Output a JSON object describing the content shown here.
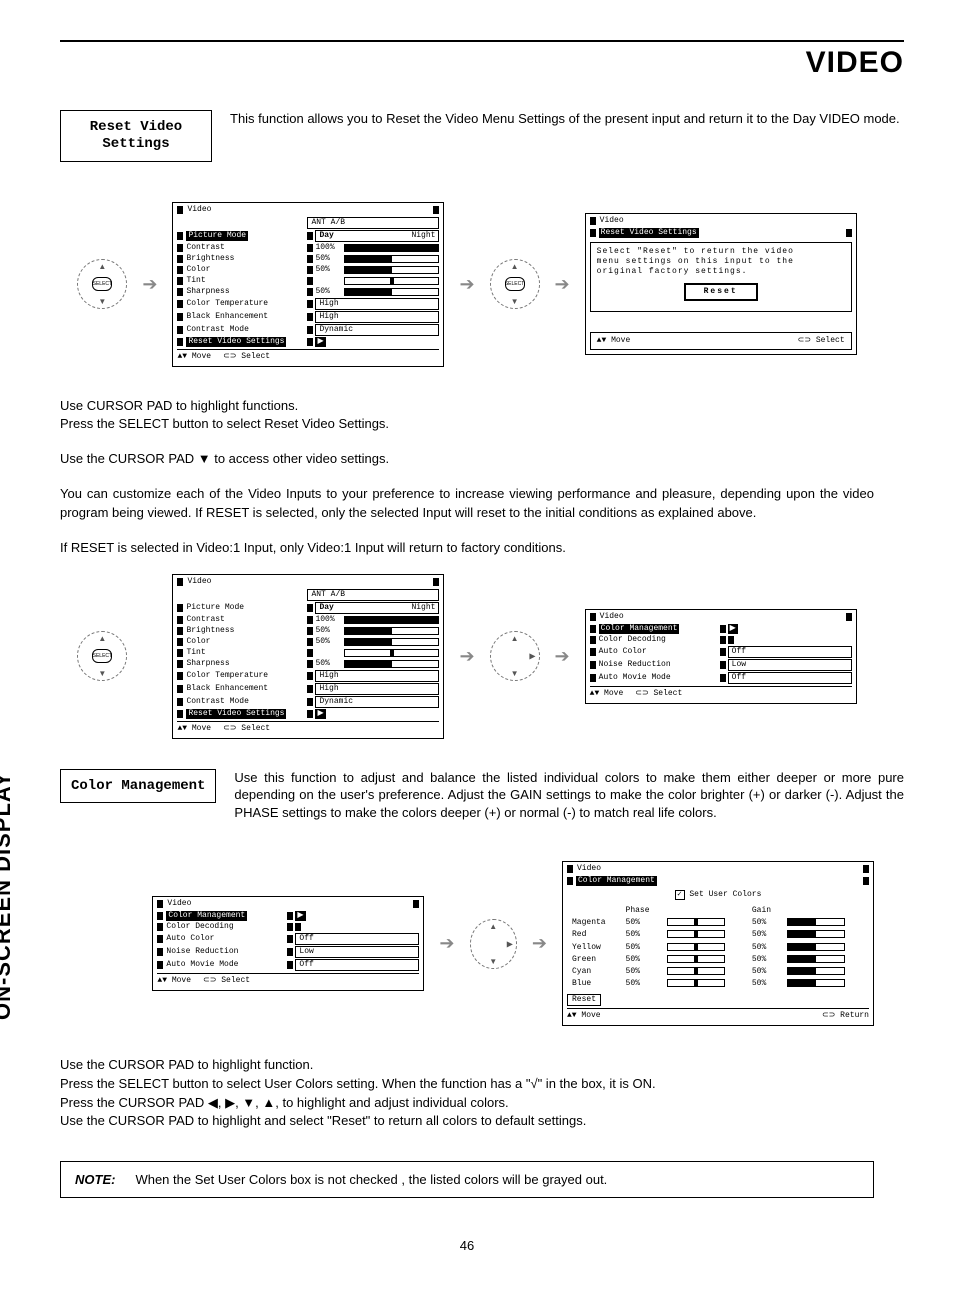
{
  "header": {
    "title": "VIDEO"
  },
  "side_label": "ON-SCREEN DISPLAY",
  "page_number": "46",
  "reset_section": {
    "label": "Reset Video \nSettings",
    "desc": "This function allows you to Reset the Video Menu Settings of the present input and return it to the Day VIDEO mode."
  },
  "remote": {
    "center": "SELECT",
    "right": "▶"
  },
  "menu1": {
    "title": "Video",
    "value_header": "ANT A/B",
    "items": [
      {
        "label": "Picture Mode",
        "type": "dual",
        "a": "Day",
        "b": "Night",
        "sel": true
      },
      {
        "label": "Contrast",
        "type": "bar",
        "pct": 100,
        "text": "100%"
      },
      {
        "label": "Brightness",
        "type": "bar",
        "pct": 50,
        "text": "50%"
      },
      {
        "label": "Color",
        "type": "bar",
        "pct": 50,
        "text": "50%"
      },
      {
        "label": "Tint",
        "type": "bar_center"
      },
      {
        "label": "Sharpness",
        "type": "bar",
        "pct": 50,
        "text": "50%"
      },
      {
        "label": "Color Temperature",
        "type": "box",
        "text": "High"
      },
      {
        "label": "Black Enhancement",
        "type": "box",
        "text": "High"
      },
      {
        "label": "Contrast Mode",
        "type": "box",
        "text": "Dynamic"
      },
      {
        "label": "Reset Video Settings",
        "type": "arrow",
        "sel": true
      }
    ],
    "foot_move": "Move",
    "foot_select": "Select"
  },
  "reset_dialog": {
    "title": "Video",
    "sub": "Reset Video Settings",
    "msg1": "Select \"Reset\" to return the video",
    "msg2": "menu settings on this input to the",
    "msg3": "original factory settings.",
    "button": "Reset",
    "foot_move": "Move",
    "foot_select": "Select"
  },
  "body": {
    "p1": "Use CURSOR PAD to highlight functions.",
    "p2": "Press the SELECT button to select Reset Video Settings.",
    "p3": "Use the CURSOR PAD ▼ to access other video settings.",
    "p4": "You can customize each of the Video Inputs to your preference to increase viewing performance and pleasure, depending upon the video program being viewed. If RESET is selected, only the selected Input will reset to the initial conditions as explained above.",
    "p5": "If RESET is selected in Video:1 Input, only Video:1 Input will return to factory conditions."
  },
  "menu2": {
    "title": "Video",
    "value_header": "ANT A/B",
    "items": [
      {
        "label": "Picture Mode",
        "type": "dual",
        "a": "Day",
        "b": "Night"
      },
      {
        "label": "Contrast",
        "type": "bar",
        "pct": 100,
        "text": "100%"
      },
      {
        "label": "Brightness",
        "type": "bar",
        "pct": 50,
        "text": "50%"
      },
      {
        "label": "Color",
        "type": "bar",
        "pct": 50,
        "text": "50%"
      },
      {
        "label": "Tint",
        "type": "bar_center"
      },
      {
        "label": "Sharpness",
        "type": "bar",
        "pct": 50,
        "text": "50%"
      },
      {
        "label": "Color Temperature",
        "type": "box",
        "text": "High"
      },
      {
        "label": "Black Enhancement",
        "type": "box",
        "text": "High"
      },
      {
        "label": "Contrast Mode",
        "type": "box",
        "text": "Dynamic"
      },
      {
        "label": "Reset Video Settings",
        "type": "arrow",
        "sel": true
      }
    ],
    "foot_move": "Move",
    "foot_select": "Select"
  },
  "menu_video2": {
    "title": "Video",
    "items": [
      {
        "label": "Color Management",
        "type": "arrow",
        "sel": true
      },
      {
        "label": "Color Decoding",
        "type": "none"
      },
      {
        "label": "Auto Color",
        "type": "box",
        "text": "Off"
      },
      {
        "label": "Noise Reduction",
        "type": "box",
        "text": "Low"
      },
      {
        "label": "Auto Movie Mode",
        "type": "box",
        "text": "Off"
      }
    ],
    "foot_move": "Move",
    "foot_select": "Select"
  },
  "color_mgmt_section": {
    "label": "Color Management",
    "desc": "Use this function to adjust and balance the listed individual colors to make them either deeper or more pure depending on the user's preference.  Adjust the GAIN settings to make the color brighter (+) or darker (-).  Adjust the PHASE settings to make the colors deeper (+) or normal (-) to match real life colors."
  },
  "menu_video3": {
    "title": "Video",
    "items": [
      {
        "label": "Color Management",
        "type": "arrow",
        "sel": true
      },
      {
        "label": "Color Decoding",
        "type": "none"
      },
      {
        "label": "Auto Color",
        "type": "box",
        "text": "Off"
      },
      {
        "label": "Noise Reduction",
        "type": "box",
        "text": "Low"
      },
      {
        "label": "Auto Movie Mode",
        "type": "box",
        "text": "Off"
      }
    ],
    "foot_move": "Move",
    "foot_select": "Select"
  },
  "color_detail": {
    "title": "Video",
    "sub": "Color Management",
    "check_label": "Set User Colors",
    "col_phase": "Phase",
    "col_gain": "Gain",
    "rows": [
      {
        "name": "Magenta",
        "phase": "50%",
        "gain": "50%"
      },
      {
        "name": "Red",
        "phase": "50%",
        "gain": "50%"
      },
      {
        "name": "Yellow",
        "phase": "50%",
        "gain": "50%"
      },
      {
        "name": "Green",
        "phase": "50%",
        "gain": "50%"
      },
      {
        "name": "Cyan",
        "phase": "50%",
        "gain": "50%"
      },
      {
        "name": "Blue",
        "phase": "50%",
        "gain": "50%"
      }
    ],
    "reset": "Reset",
    "foot_move": "Move",
    "foot_return": "Return"
  },
  "body2": {
    "p1": "Use the CURSOR PAD to highlight function.",
    "p2": "Press the SELECT button to select User Colors setting.  When the function has a \"√\" in the box, it is ON.",
    "p3": "Press  the CURSOR PAD ◀, ▶, ▼, ▲, to highlight and adjust individual colors.",
    "p4": "Use  the CURSOR PAD to highlight and select \"Reset\" to return all colors to default settings."
  },
  "note": {
    "label": "NOTE:",
    "text": "When the Set User Colors box is not checked , the listed colors will be grayed out."
  }
}
